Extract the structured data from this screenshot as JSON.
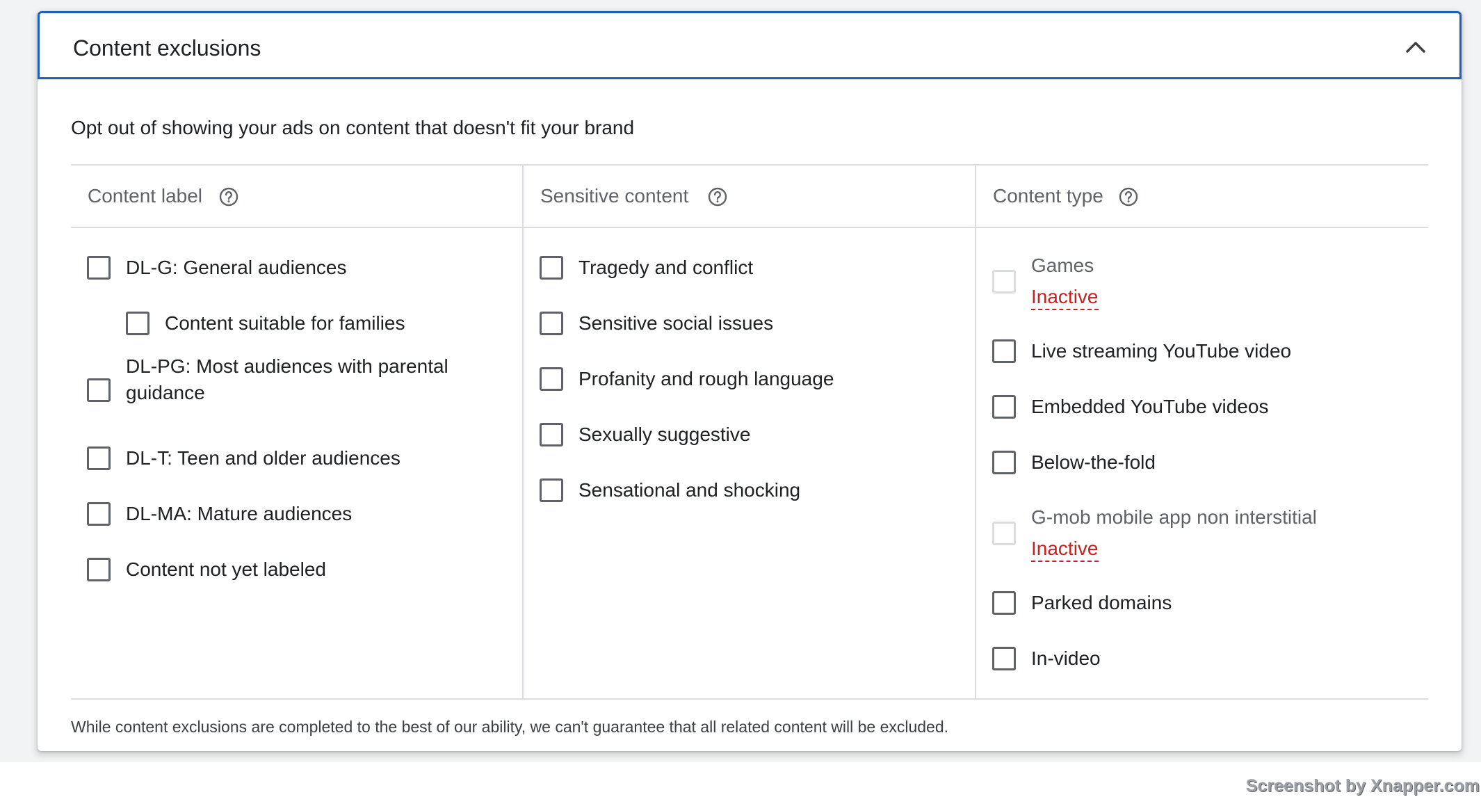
{
  "card": {
    "title": "Content exclusions",
    "subtitle": "Opt out of showing your ads on content that doesn't fit your brand",
    "footer": "While content exclusions are completed to the best of our ability, we can't guarantee that all related content will be excluded."
  },
  "columns": [
    {
      "header": "Content label",
      "items": [
        {
          "label": "DL-G: General audiences"
        },
        {
          "label": "Content suitable for families"
        },
        {
          "label": "DL-PG: Most audiences with parental guidance"
        },
        {
          "label": "DL-T: Teen and older audiences"
        },
        {
          "label": "DL-MA: Mature audiences"
        },
        {
          "label": "Content not yet labeled"
        }
      ]
    },
    {
      "header": "Sensitive content",
      "items": [
        {
          "label": "Tragedy and conflict"
        },
        {
          "label": "Sensitive social issues"
        },
        {
          "label": "Profanity and rough language"
        },
        {
          "label": "Sexually suggestive"
        },
        {
          "label": "Sensational and shocking"
        }
      ]
    },
    {
      "header": "Content type",
      "items": [
        {
          "label": "Games",
          "status": "Inactive"
        },
        {
          "label": "Live streaming YouTube video"
        },
        {
          "label": "Embedded YouTube videos"
        },
        {
          "label": "Below-the-fold"
        },
        {
          "label": "G-mob mobile app non interstitial",
          "status": "Inactive"
        },
        {
          "label": "Parked domains"
        },
        {
          "label": "In-video"
        }
      ]
    }
  ],
  "icons": {
    "collapse": "chevron-up-icon",
    "help": "help-circle-icon"
  },
  "colors": {
    "header_border": "#1f5fbf",
    "inactive": "#c5221f"
  },
  "watermark": "Screenshot by Xnapper.com"
}
